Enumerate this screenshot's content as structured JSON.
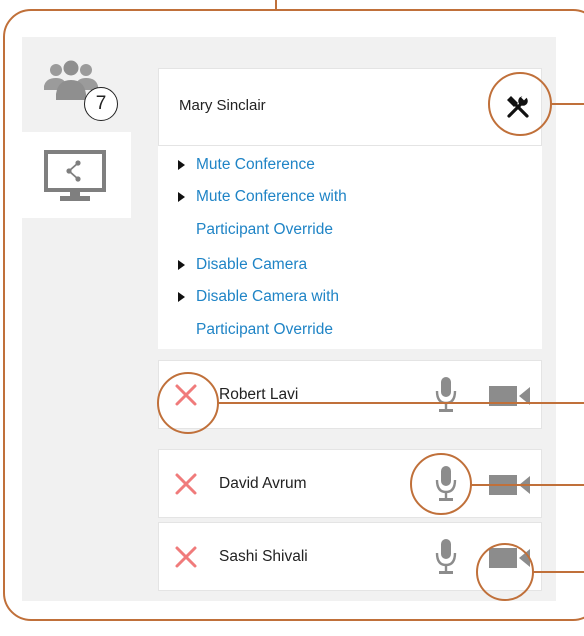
{
  "sidebar": {
    "participants_tab": {
      "icon": "people-icon",
      "count": "7"
    },
    "share_tab": {
      "icon": "screen-share-icon"
    }
  },
  "host": {
    "name": "Mary Sinclair",
    "settings_icon": "tools-icon"
  },
  "host_menu": {
    "items": [
      {
        "lines": [
          "Mute Conference"
        ]
      },
      {
        "lines": [
          "Mute Conference with",
          "Participant Override"
        ]
      },
      {
        "lines": [
          "Disable Camera"
        ]
      },
      {
        "lines": [
          "Disable Camera with",
          "Participant Override"
        ]
      }
    ]
  },
  "participants": [
    {
      "name": "Robert Lavi"
    },
    {
      "name": "David Avrum"
    },
    {
      "name": "Sashi Shivali"
    }
  ],
  "colors": {
    "accent": "#c0703a",
    "link": "#1f84c6",
    "remove": "#f07b7b",
    "icon_gray": "#8c8c8c"
  }
}
